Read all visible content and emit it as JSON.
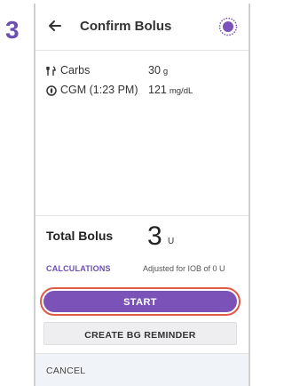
{
  "step_number": "3",
  "header": {
    "title": "Confirm Bolus",
    "back_icon": "arrow-left-icon",
    "status_icon": "pump-status-icon"
  },
  "details": [
    {
      "icon": "fork-knife-icon",
      "label": "Carbs",
      "value": "30",
      "unit": "g"
    },
    {
      "icon": "cgm-sensor-icon",
      "label": "CGM (1:23 PM)",
      "value": "121",
      "unit": "mg/dL"
    }
  ],
  "total": {
    "label": "Total Bolus",
    "value": "3",
    "unit": "U",
    "calculations_label": "CALCULATIONS",
    "adjusted_note": "Adjusted for IOB of 0 U"
  },
  "actions": {
    "start_label": "START",
    "reminder_label": "CREATE BG REMINDER",
    "cancel_label": "CANCEL"
  },
  "colors": {
    "accent": "#7b53b8",
    "step_number": "#6b4fb3",
    "highlight_outline": "#e05a48"
  }
}
